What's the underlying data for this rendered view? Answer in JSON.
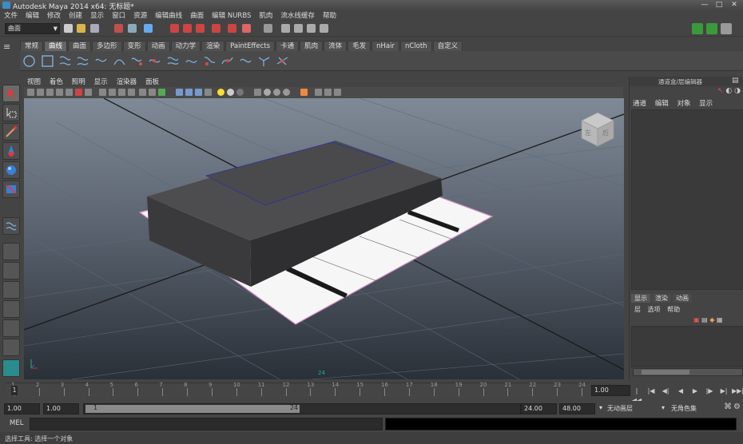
{
  "window": {
    "title": "Autodesk Maya 2014 x64: 无标题*",
    "controls": [
      "—",
      "□",
      "✕"
    ]
  },
  "menubar": [
    "文件",
    "编辑",
    "修改",
    "创建",
    "显示",
    "窗口",
    "资源",
    "编辑曲线",
    "曲面",
    "编辑 NURBS",
    "肌肉",
    "流水线缓存",
    "帮助"
  ],
  "statusline": {
    "mode": "曲面"
  },
  "shelf_tabs": [
    "常规",
    "曲线",
    "曲面",
    "多边形",
    "变形",
    "动画",
    "动力学",
    "渲染",
    "PaintEffects",
    "卡通",
    "肌肉",
    "流体",
    "毛发",
    "nHair",
    "nCloth",
    "自定义"
  ],
  "shelf_active_index": 1,
  "viewport": {
    "menu": [
      "视图",
      "着色",
      "照明",
      "显示",
      "渲染器",
      "面板"
    ],
    "viewcube_labels": [
      "左",
      "后"
    ],
    "frame_number": "24"
  },
  "channel_box": {
    "header": "通道盒/层编辑器",
    "menu": [
      "通道",
      "编辑",
      "对象",
      "显示"
    ],
    "layer_tabs": [
      "显示",
      "渲染",
      "动画"
    ],
    "layer_menu": [
      "层",
      "选项",
      "帮助"
    ]
  },
  "time_slider": {
    "ticks": [
      "1",
      "2",
      "3",
      "4",
      "5",
      "6",
      "7",
      "8",
      "9",
      "10",
      "11",
      "12",
      "13",
      "14",
      "15",
      "16",
      "17",
      "18",
      "19",
      "20",
      "21",
      "22",
      "23",
      "24"
    ],
    "current_frame_label": "1",
    "current_time": "1.00"
  },
  "range": {
    "start": "1.00",
    "playback_start": "1.00",
    "slider_start": "1",
    "slider_end": "24",
    "playback_end": "24.00",
    "end": "48.00",
    "anim_layer": "无动画层",
    "char_set": "无角色集"
  },
  "command_line": {
    "label": "MEL"
  },
  "help_line": {
    "text": "选择工具: 选择一个对象"
  },
  "colors": {
    "accent_active": "#6a6a6a",
    "grid": "#1b1b1b",
    "outline": "#c48ab8"
  }
}
